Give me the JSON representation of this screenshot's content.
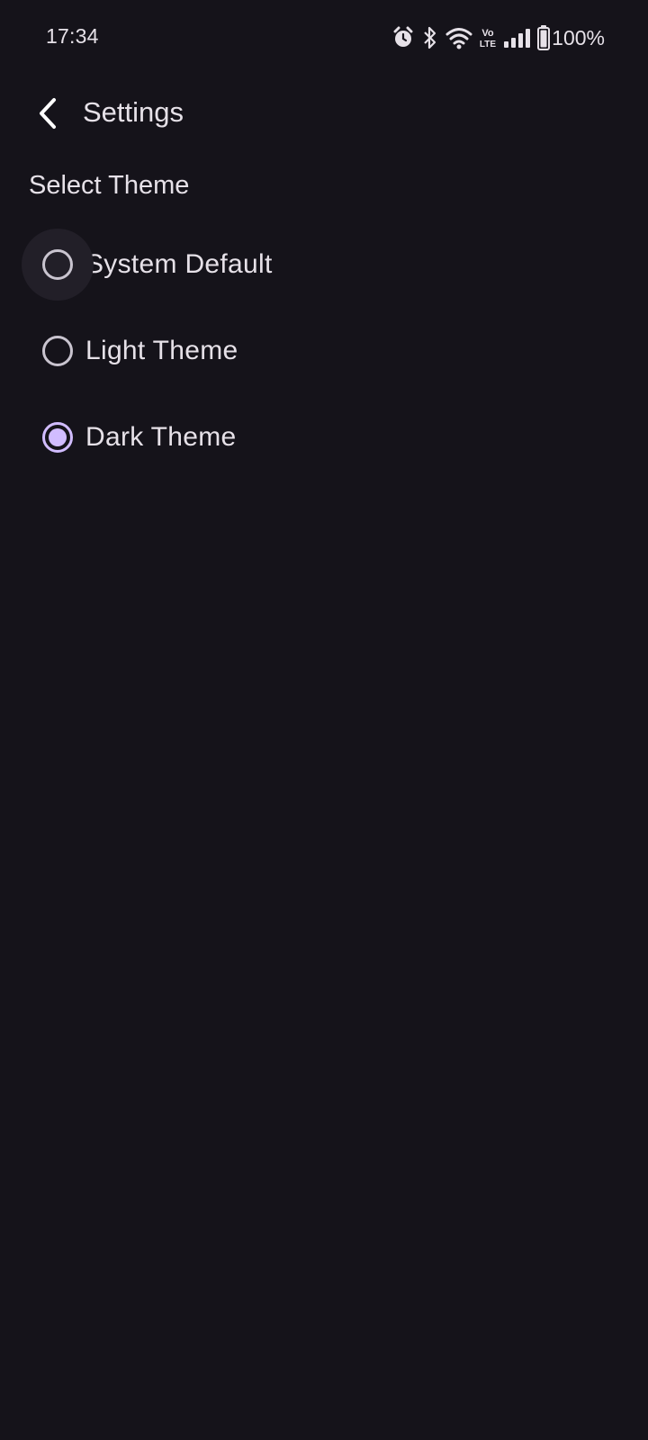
{
  "status_bar": {
    "time": "17:34",
    "icons": [
      "alarm-icon",
      "bluetooth-icon",
      "wifi-icon",
      "volte-icon",
      "signal-icon",
      "battery-icon"
    ],
    "volte_text": "Vo LTE",
    "battery_percent": "100%"
  },
  "app_bar": {
    "back_icon": "chevron-left-icon",
    "title": "Settings"
  },
  "theme_section": {
    "title": "Select Theme",
    "options": [
      {
        "label": "System Default",
        "selected": false
      },
      {
        "label": "Light Theme",
        "selected": false
      },
      {
        "label": "Dark Theme",
        "selected": true
      }
    ]
  },
  "colors": {
    "background": "#15131a",
    "text": "#e6e1e8",
    "accent": "#d1bcff",
    "radio_unselected": "#c9c4cf"
  }
}
